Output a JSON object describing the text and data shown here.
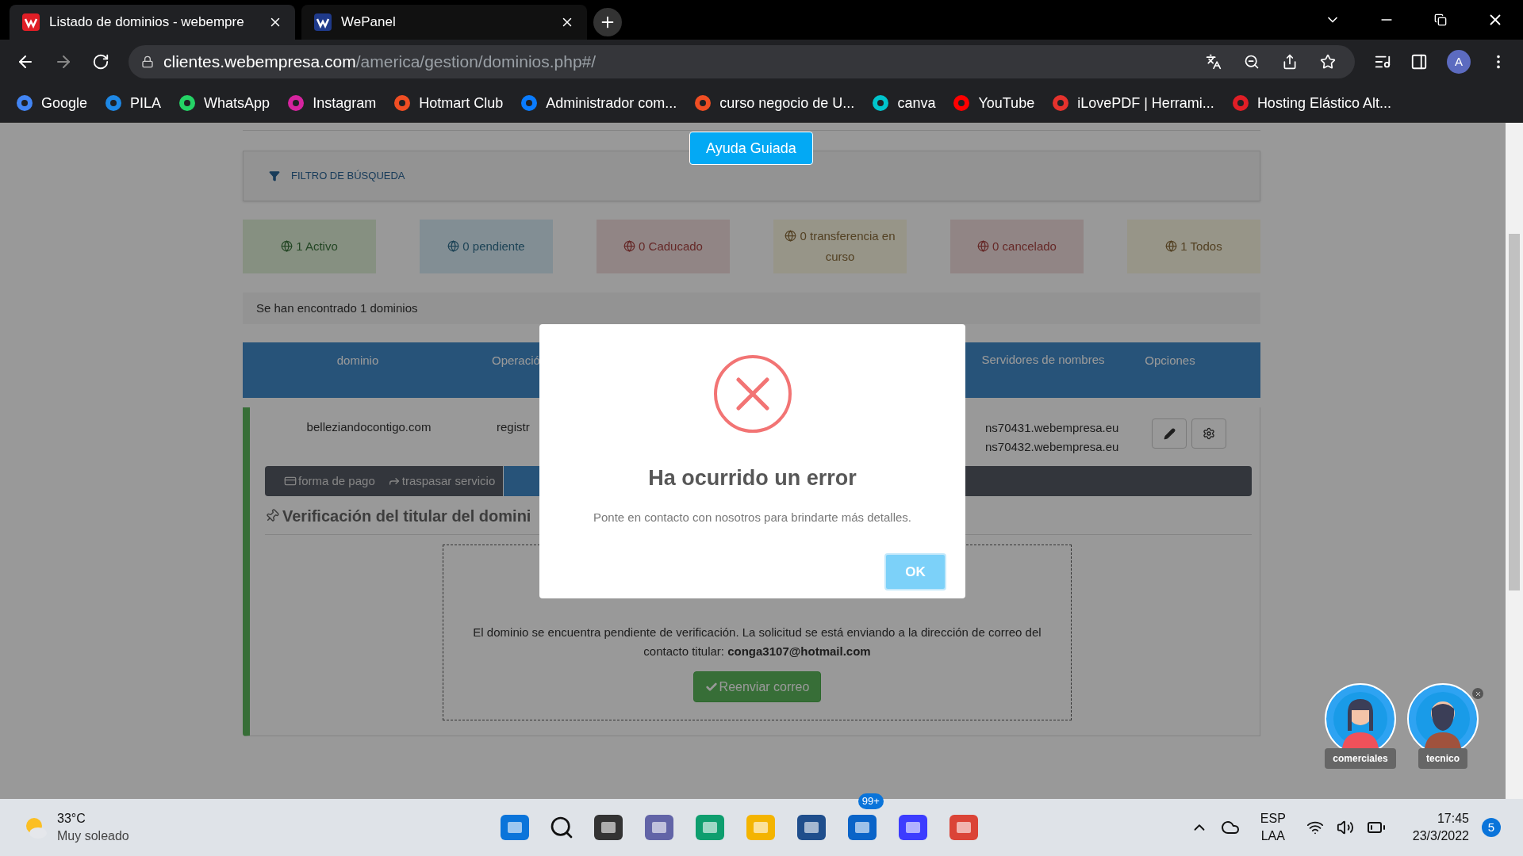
{
  "browser": {
    "tabs": [
      {
        "title": "Listado de dominios - webempre",
        "selected": true,
        "color": "#e01e26"
      },
      {
        "title": "WePanel",
        "selected": false,
        "color": "#1f3a8a"
      }
    ],
    "url": {
      "host": "clientes.webempresa.com",
      "path": "/america/gestion/dominios.php#/"
    },
    "profile": "A",
    "bookmarks": [
      {
        "label": "Google",
        "color": "#4285f4"
      },
      {
        "label": "PILA",
        "color": "#1e88e5"
      },
      {
        "label": "WhatsApp",
        "color": "#25d366"
      },
      {
        "label": "Instagram",
        "color": "#d6249f"
      },
      {
        "label": "Hotmart Club",
        "color": "#f04e23"
      },
      {
        "label": "Administrador com...",
        "color": "#0a7cff"
      },
      {
        "label": "curso negocio de U...",
        "color": "#f04e23"
      },
      {
        "label": "canva",
        "color": "#00c4cc"
      },
      {
        "label": "YouTube",
        "color": "#ff0000"
      },
      {
        "label": "iLovePDF | Herrami...",
        "color": "#e5322d"
      },
      {
        "label": "Hosting Elástico Alt...",
        "color": "#e01e26"
      }
    ]
  },
  "page": {
    "guide_button": "Ayuda Guiada",
    "filter_label": "FILTRO DE BÚSQUEDA",
    "status_cards": [
      {
        "count": "1",
        "label": "Activo",
        "kind": "success"
      },
      {
        "count": "0",
        "label": "pendiente",
        "kind": "info"
      },
      {
        "count": "0",
        "label": "Caducado",
        "kind": "danger"
      },
      {
        "count": "0",
        "label": "transferencia en curso",
        "kind": "warning"
      },
      {
        "count": "0",
        "label": "cancelado",
        "kind": "danger"
      },
      {
        "count": "1",
        "label": "Todos",
        "kind": "warning"
      }
    ],
    "results_text": "Se han encontrado 1 dominios",
    "table": {
      "columns": [
        "dominio",
        "Operació",
        "Servidores de nombres",
        "Opciones"
      ],
      "row": {
        "domain": "belleziandocontigo.com",
        "operation": "registr",
        "nameservers": [
          "ns70431.webempresa.eu",
          "ns70432.webempresa.eu"
        ]
      }
    },
    "service_tabs": [
      {
        "label": "forma de pago",
        "selected": false
      },
      {
        "label": "traspasar servicio",
        "selected": false
      },
      {
        "selected": true
      }
    ],
    "verification_title": "Verificación del titular del domini",
    "verification_text": "El dominio se encuentra pendiente de verificación. La solicitud se está enviando a la dirección de correo del contacto titular: **conga3107@hotmail.com**",
    "resend_button": "Reenviar correo"
  },
  "modal": {
    "title": "Ha ocurrido un error",
    "message": "Ponte en contacto con nosotros para brindarte más detalles.",
    "button": "OK"
  },
  "chat_agents": [
    {
      "label": "comerciales"
    },
    {
      "label": "tecnico"
    }
  ],
  "taskbar": {
    "temperature": "33°C",
    "weather": "Muy soleado",
    "mail_badge": "99+",
    "language": [
      "ESP",
      "LAA"
    ],
    "time": "17:45",
    "date": "23/3/2022",
    "notifications": "5"
  }
}
